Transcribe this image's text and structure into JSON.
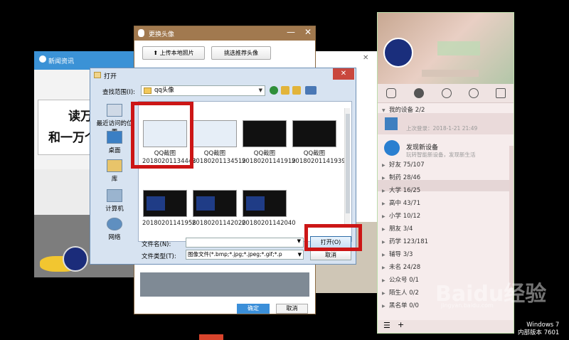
{
  "back_window": {
    "title": "新闻资讯",
    "headline_1": "读万",
    "headline_2": "和一万个"
  },
  "avatar_window": {
    "title": "更换头像",
    "upload_local": "上传本地照片",
    "pick_recommended": "挑选推荐头像",
    "minimize": "—",
    "close": "✕",
    "ok": "确定",
    "cancel": "取消"
  },
  "mid_window": {
    "close": "✕"
  },
  "open_dialog": {
    "title": "打开",
    "close": "✕",
    "look_in_label": "查找范围(I):",
    "look_in_value": "qq头像",
    "places": [
      {
        "label": "最近访问的位置"
      },
      {
        "label": "桌面"
      },
      {
        "label": "库"
      },
      {
        "label": "计算机"
      },
      {
        "label": "网络"
      }
    ],
    "files": [
      {
        "line1": "QQ截图",
        "line2": "20180201134443"
      },
      {
        "line1": "QQ截图",
        "line2": "20180201134519"
      },
      {
        "line1": "QQ截图",
        "line2": "20180201141919"
      },
      {
        "line1": "QQ截图",
        "line2": "20180201141939"
      },
      {
        "line1": "",
        "line2": "20180201141958"
      },
      {
        "line1": "",
        "line2": "20180201142020"
      },
      {
        "line1": "",
        "line2": "20180201142040"
      }
    ],
    "file_name_label": "文件名(N):",
    "file_name_value": "",
    "file_type_label": "文件类型(T):",
    "file_type_value": "图像文件(*.bmp;*.jpg;*.jpeg;*.gif;*.p",
    "open_button": "打开(O)",
    "cancel_button": "取消"
  },
  "qq_panel": {
    "my_devices": "我的设备 2/2",
    "last_login": "上次登录：2018-1-21 21:49",
    "discover_title": "发现新设备",
    "discover_sub": "玩转智能新设备，发现新生活",
    "groups": [
      {
        "name": "好友",
        "count": "75/107"
      },
      {
        "name": "制药",
        "count": "28/46"
      },
      {
        "name": "大学",
        "count": "16/25"
      },
      {
        "name": "高中",
        "count": "43/71"
      },
      {
        "name": "小学",
        "count": "10/12"
      },
      {
        "name": "朋友",
        "count": "3/4"
      },
      {
        "name": "药学",
        "count": "123/181"
      },
      {
        "name": "辅导",
        "count": "3/3"
      },
      {
        "name": "未名",
        "count": "24/28"
      },
      {
        "name": "公众号",
        "count": "0/1"
      },
      {
        "name": "陌生人",
        "count": "0/2"
      },
      {
        "name": "黑名单",
        "count": "0/0"
      }
    ],
    "footer_menu": "☰",
    "footer_add": "+"
  },
  "watermark": {
    "baidu": "Baidu经验",
    "baidu_url": "jingyan.baidu.com",
    "os_line1": "Windows 7",
    "os_line2": "内部版本 7601"
  },
  "colors": {
    "highlight_red": "#cc1616",
    "qq_title_brown": "#a1794f",
    "dialog_frame": "#d7e3f1"
  }
}
